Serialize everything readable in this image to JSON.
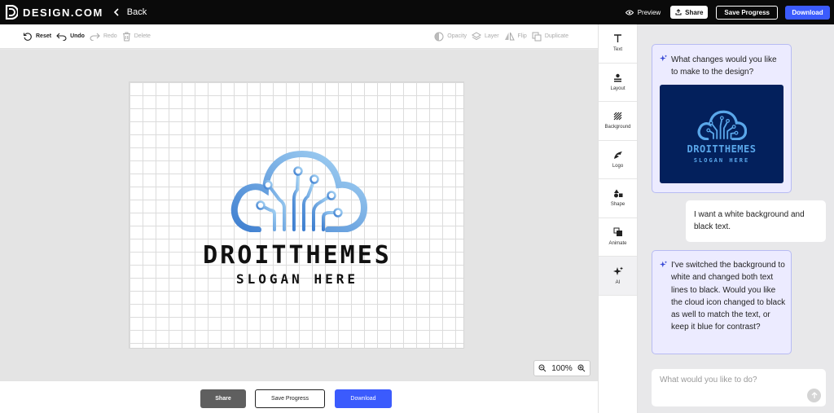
{
  "header": {
    "brand": "DESIGN.COM",
    "back_label": "Back",
    "preview_label": "Preview",
    "share_label": "Share",
    "save_progress_label": "Save Progress",
    "download_label": "Download"
  },
  "toolbar": {
    "reset": "Reset",
    "undo": "Undo",
    "redo": "Redo",
    "delete": "Delete",
    "opacity": "Opacity",
    "layer": "Layer",
    "flip": "Flip",
    "duplicate": "Duplicate"
  },
  "canvas": {
    "logo_name": "DROITTHEMES",
    "logo_slogan": "SLOGAN HERE",
    "zoom_level": "100%",
    "logo_gradient": [
      "#3f7fd0",
      "#a9d6f5"
    ],
    "text_color": "#111111"
  },
  "bottom": {
    "share_label": "Share",
    "save_progress_label": "Save Progress",
    "download_label": "Download"
  },
  "tools": [
    {
      "label": "Text",
      "icon": "text-icon"
    },
    {
      "label": "Layout",
      "icon": "layout-icon"
    },
    {
      "label": "Background",
      "icon": "background-icon"
    },
    {
      "label": "Logo",
      "icon": "logo-icon"
    },
    {
      "label": "Shape",
      "icon": "shape-icon"
    },
    {
      "label": "Animate",
      "icon": "animate-icon"
    },
    {
      "label": "AI",
      "icon": "sparkle-icon"
    }
  ],
  "chat": {
    "messages": [
      {
        "role": "assistant",
        "text": "What changes would you like to make to the design?"
      },
      {
        "role": "user",
        "text": "I want a white background and black text."
      },
      {
        "role": "assistant",
        "text": "I've switched the background to white and changed both text lines to black. Would you like the cloud icon changed to black as well to match the text, or keep it blue for contrast?"
      }
    ],
    "thumbnail": {
      "name": "DROITTHEMES",
      "slogan": "SLOGAN HERE",
      "background": "#03205c",
      "accent": "#5aa7ea"
    },
    "input_placeholder": "What would you like to do?"
  },
  "colors": {
    "accent": "#3b5bfd",
    "topbar": "#0a0a0a"
  }
}
